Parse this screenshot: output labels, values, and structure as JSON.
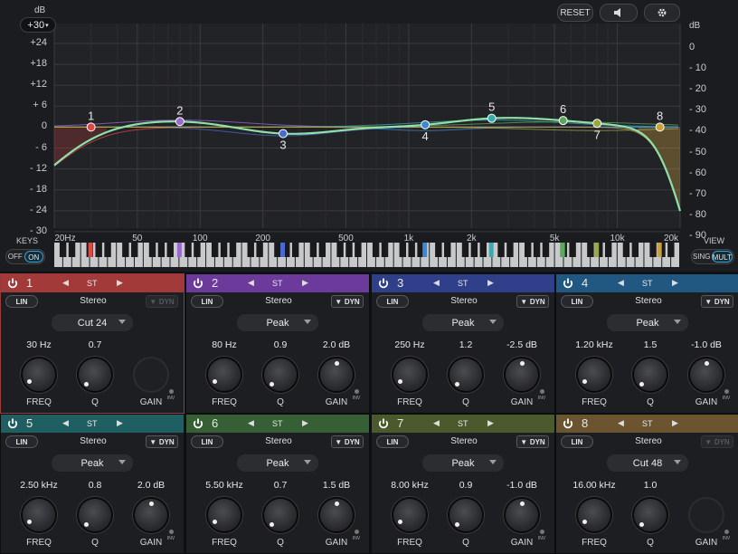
{
  "header": {
    "db_label": "dB",
    "db_range": "+30",
    "reset_label": "RESET",
    "speaker_icon": "speaker-icon",
    "gear_icon": "gear-icon"
  },
  "axis": {
    "left": [
      "+24",
      "+18",
      "+12",
      "+ 6",
      "0",
      "- 6",
      "- 12",
      "- 18",
      "- 24",
      "- 30"
    ],
    "right_unit": "dB",
    "right": [
      "0",
      "- 10",
      "- 20",
      "- 30",
      "- 40",
      "- 50",
      "- 60",
      "- 70",
      "- 80",
      "- 90"
    ],
    "freq": [
      "20Hz",
      "50",
      "100",
      "200",
      "500",
      "1k",
      "2k",
      "5k",
      "10k",
      "20k"
    ]
  },
  "keys": {
    "label": "KEYS",
    "off": "OFF",
    "on": "ON"
  },
  "view": {
    "label": "VIEW",
    "sing": "SING",
    "mult": "MULT"
  },
  "bands": [
    {
      "num": "1",
      "channel": "ST",
      "mode": "Stereo",
      "lin": "LIN",
      "dyn": "DYN",
      "type": "Cut 24",
      "freq": "30 Hz",
      "q": "0.7",
      "gain": "",
      "color": "#a33a3a",
      "point_color": "#e04646",
      "freq_hz": 30,
      "gain_db": 0
    },
    {
      "num": "2",
      "channel": "ST",
      "mode": "Stereo",
      "lin": "LIN",
      "dyn": "DYN",
      "type": "Peak",
      "freq": "80 Hz",
      "q": "0.9",
      "gain": "2.0 dB",
      "color": "#6b3a9a",
      "point_color": "#9a6ad0",
      "freq_hz": 80,
      "gain_db": 2.0
    },
    {
      "num": "3",
      "channel": "ST",
      "mode": "Stereo",
      "lin": "LIN",
      "dyn": "DYN",
      "type": "Peak",
      "freq": "250 Hz",
      "q": "1.2",
      "gain": "-2.5 dB",
      "color": "#2f3f8a",
      "point_color": "#4a6ad0",
      "freq_hz": 250,
      "gain_db": -2.5
    },
    {
      "num": "4",
      "channel": "ST",
      "mode": "Stereo",
      "lin": "LIN",
      "dyn": "DYN",
      "type": "Peak",
      "freq": "1.20 kHz",
      "q": "1.5",
      "gain": "-1.0 dB",
      "color": "#215882",
      "point_color": "#3a8ad0",
      "freq_hz": 1200,
      "gain_db": -1.0
    },
    {
      "num": "5",
      "channel": "ST",
      "mode": "Stereo",
      "lin": "LIN",
      "dyn": "DYN",
      "type": "Peak",
      "freq": "2.50 kHz",
      "q": "0.8",
      "gain": "2.0 dB",
      "color": "#1f5f62",
      "point_color": "#3aaab0",
      "freq_hz": 2500,
      "gain_db": 2.0
    },
    {
      "num": "6",
      "channel": "ST",
      "mode": "Stereo",
      "lin": "LIN",
      "dyn": "DYN",
      "type": "Peak",
      "freq": "5.50 kHz",
      "q": "0.7",
      "gain": "1.5 dB",
      "color": "#365f35",
      "point_color": "#5aa85a",
      "freq_hz": 5500,
      "gain_db": 1.5
    },
    {
      "num": "7",
      "channel": "ST",
      "mode": "Stereo",
      "lin": "LIN",
      "dyn": "DYN",
      "type": "Peak",
      "freq": "8.00 kHz",
      "q": "0.9",
      "gain": "-1.0 dB",
      "color": "#4b5a2c",
      "point_color": "#9aa840",
      "freq_hz": 8000,
      "gain_db": -1.0
    },
    {
      "num": "8",
      "channel": "ST",
      "mode": "Stereo",
      "lin": "LIN",
      "dyn": "DYN",
      "type": "Cut 48",
      "freq": "16.00 kHz",
      "q": "1.0",
      "gain": "",
      "color": "#6a5530",
      "point_color": "#c9a040",
      "freq_hz": 16000,
      "gain_db": 0
    }
  ],
  "knob_labels": {
    "freq": "FREQ",
    "q": "Q",
    "gain": "GAIN",
    "inv": "INV"
  }
}
